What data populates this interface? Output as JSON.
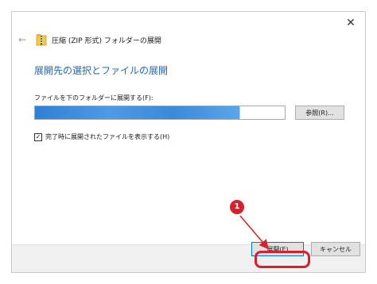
{
  "window": {
    "title": "圧縮 (ZIP 形式) フォルダーの展開",
    "close_glyph": "✕",
    "back_glyph": "←"
  },
  "main": {
    "heading": "展開先の選択とファイルの展開",
    "field_label": "ファイルを下のフォルダーに展開する(F):",
    "path_value": "",
    "browse_label": "参照(R)...",
    "checkbox_label": "完了時に展開されたファイルを表示する(H)",
    "checkbox_checked": true,
    "checkbox_glyph": "✓"
  },
  "footer": {
    "extract_label": "展開(E)",
    "cancel_label": "キャンセル"
  },
  "annotation": {
    "badge_number": "1",
    "color": "#d9202a"
  },
  "colors": {
    "heading": "#1f66b8",
    "accent": "#0078d7"
  },
  "icons": {
    "zip_folder": "zip-folder-icon",
    "back": "back-arrow-icon",
    "close": "close-icon"
  }
}
